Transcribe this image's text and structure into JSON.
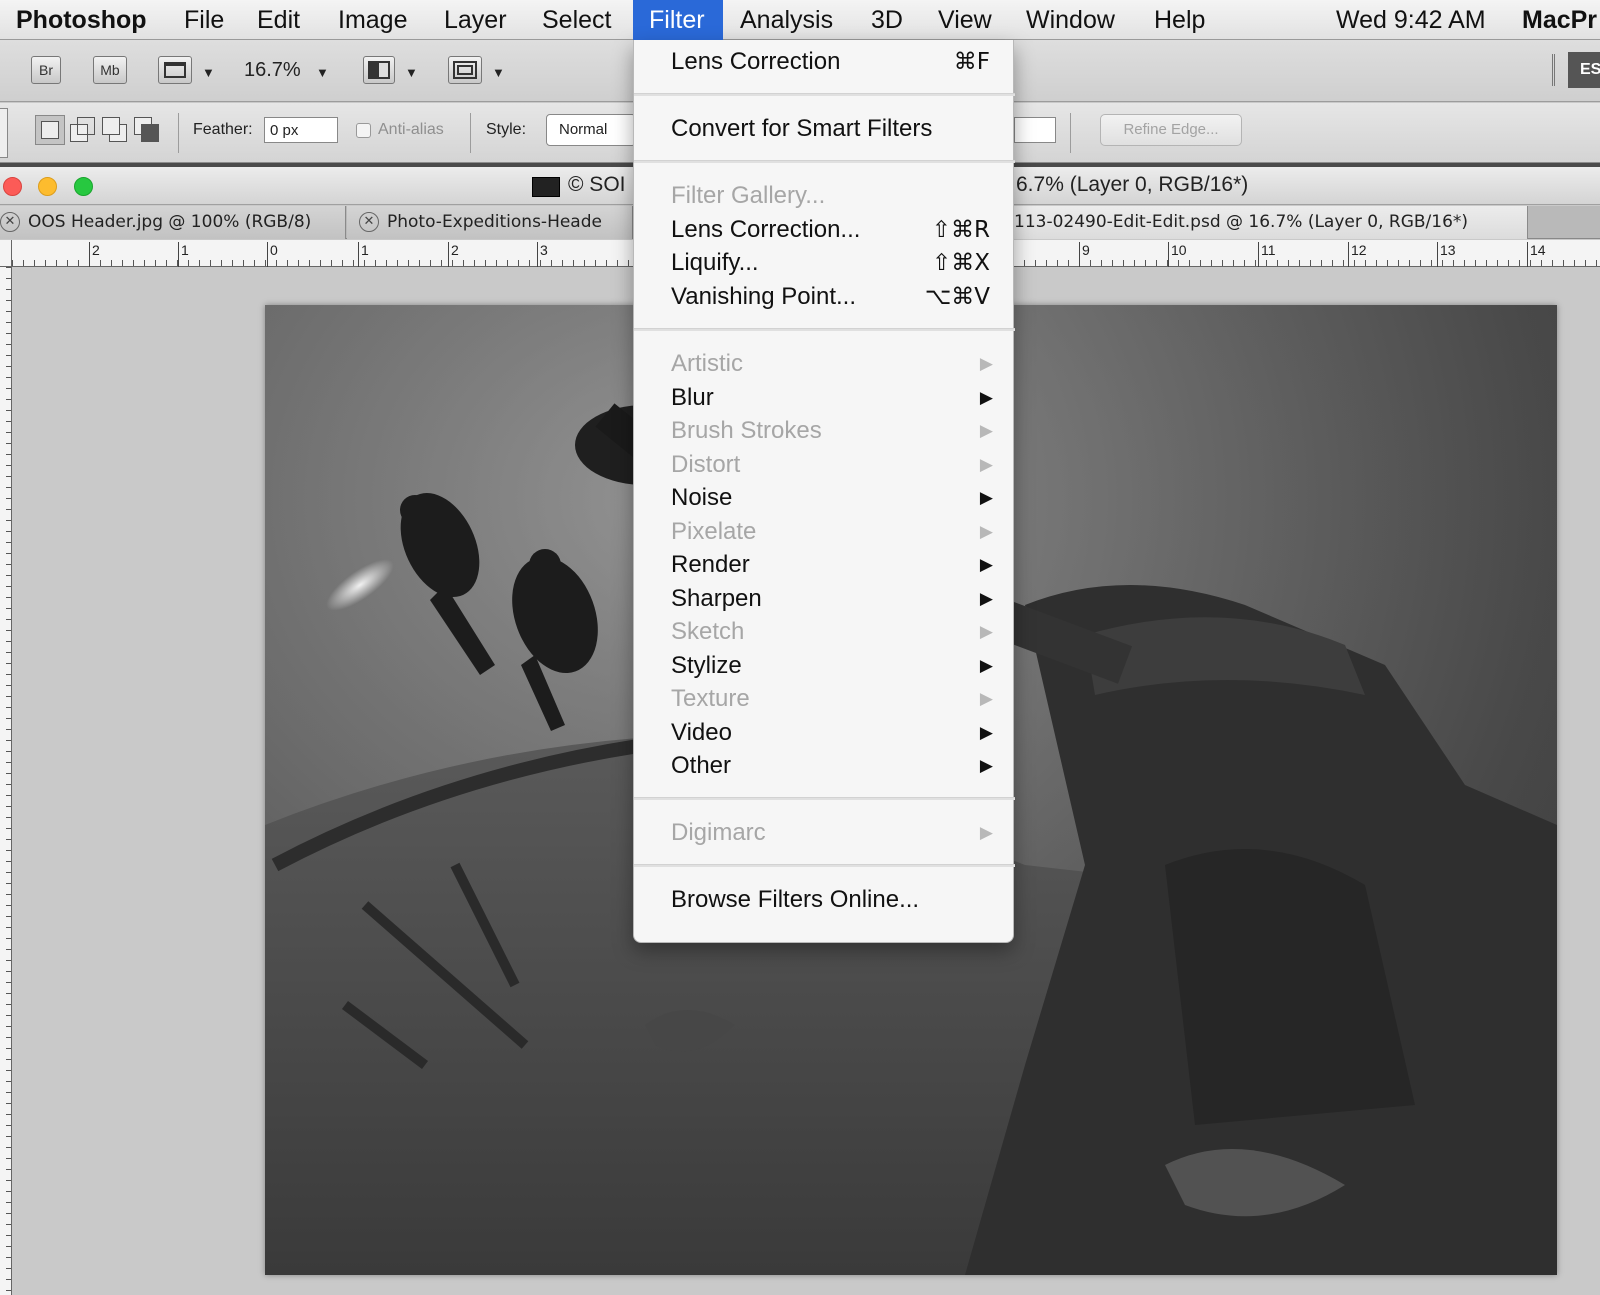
{
  "menubar": {
    "app_name": "Photoshop",
    "items": [
      "File",
      "Edit",
      "Image",
      "Layer",
      "Select",
      "Filter",
      "Analysis",
      "3D",
      "View",
      "Window",
      "Help"
    ],
    "clock": "Wed 9:42 AM",
    "right_text": "MacPr"
  },
  "appbar": {
    "bridge_label": "Br",
    "minibridge_label": "Mb",
    "zoom": "16.7%",
    "workspace_label": "ES"
  },
  "options": {
    "feather_label": "Feather:",
    "feather_value": "0 px",
    "antialias_label": "Anti-alias",
    "style_label": "Style:",
    "style_value": "Normal",
    "refine_edge_label": "Refine Edge..."
  },
  "document": {
    "title_left": "© SOI",
    "title_right": "6.7% (Layer 0, RGB/16*)"
  },
  "tabs": [
    {
      "label": "OOS Header.jpg @ 100% (RGB/8)"
    },
    {
      "label": "Photo-Expeditions-Heade"
    },
    {
      "label": "113-02490-Edit-Edit.psd @ 16.7% (Layer 0, RGB/16*)"
    }
  ],
  "ruler": {
    "numbers": [
      "2",
      "1",
      "0",
      "1",
      "2",
      "3",
      "9",
      "10",
      "11",
      "12",
      "13",
      "14"
    ]
  },
  "filter_menu": {
    "items": [
      {
        "label": "Lens Correction",
        "shortcut": "⌘F",
        "disabled": false,
        "submenu": false
      },
      {
        "label": "Convert for Smart Filters",
        "shortcut": "",
        "disabled": false,
        "submenu": false
      },
      {
        "label": "Filter Gallery...",
        "shortcut": "",
        "disabled": true,
        "submenu": false
      },
      {
        "label": "Lens Correction...",
        "shortcut": "⇧⌘R",
        "disabled": false,
        "submenu": false
      },
      {
        "label": "Liquify...",
        "shortcut": "⇧⌘X",
        "disabled": false,
        "submenu": false
      },
      {
        "label": "Vanishing Point...",
        "shortcut": "⌥⌘V",
        "disabled": false,
        "submenu": false
      },
      {
        "label": "Artistic",
        "shortcut": "",
        "disabled": true,
        "submenu": true
      },
      {
        "label": "Blur",
        "shortcut": "",
        "disabled": false,
        "submenu": true
      },
      {
        "label": "Brush Strokes",
        "shortcut": "",
        "disabled": true,
        "submenu": true
      },
      {
        "label": "Distort",
        "shortcut": "",
        "disabled": true,
        "submenu": true
      },
      {
        "label": "Noise",
        "shortcut": "",
        "disabled": false,
        "submenu": true
      },
      {
        "label": "Pixelate",
        "shortcut": "",
        "disabled": true,
        "submenu": true
      },
      {
        "label": "Render",
        "shortcut": "",
        "disabled": false,
        "submenu": true
      },
      {
        "label": "Sharpen",
        "shortcut": "",
        "disabled": false,
        "submenu": true
      },
      {
        "label": "Sketch",
        "shortcut": "",
        "disabled": true,
        "submenu": true
      },
      {
        "label": "Stylize",
        "shortcut": "",
        "disabled": false,
        "submenu": true
      },
      {
        "label": "Texture",
        "shortcut": "",
        "disabled": true,
        "submenu": true
      },
      {
        "label": "Video",
        "shortcut": "",
        "disabled": false,
        "submenu": true
      },
      {
        "label": "Other",
        "shortcut": "",
        "disabled": false,
        "submenu": true
      },
      {
        "label": "Digimarc",
        "shortcut": "",
        "disabled": true,
        "submenu": true
      },
      {
        "label": "Browse Filters Online...",
        "shortcut": "",
        "disabled": false,
        "submenu": false
      }
    ],
    "submenu_arrow": "▶"
  },
  "colors": {
    "menu_highlight": "#2a69d8",
    "disabled_text": "#a6a6a6",
    "traffic_close": "#fc5b57",
    "traffic_minimize": "#fdbc2e",
    "traffic_zoom": "#27c840"
  }
}
